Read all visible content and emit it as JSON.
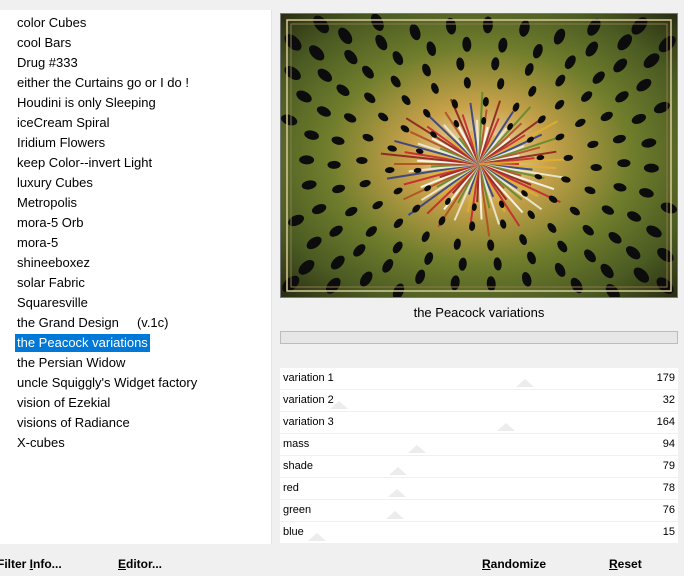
{
  "filters": [
    "color Cubes",
    "cool Bars",
    "Drug #333",
    "either the Curtains go or I do !",
    "Houdini is only Sleeping",
    "iceCream Spiral",
    "Iridium Flowers",
    "keep Color--invert Light",
    "luxury Cubes",
    "Metropolis",
    "mora-5 Orb",
    "mora-5",
    "shineeboxez",
    "solar Fabric",
    "Squaresville",
    "the Grand Design     (v.1c)",
    "the Peacock variations",
    "the Persian Widow",
    "uncle Squiggly's Widget factory",
    "vision of Ezekial",
    "visions of Radiance",
    "X-cubes"
  ],
  "selected_index": 16,
  "filter_title": "the Peacock variations",
  "sliders": [
    {
      "label": "variation 1",
      "value": 179,
      "max": 255
    },
    {
      "label": "variation 2",
      "value": 32,
      "max": 255
    },
    {
      "label": "variation 3",
      "value": 164,
      "max": 255
    },
    {
      "label": "mass",
      "value": 94,
      "max": 255
    },
    {
      "label": "shade",
      "value": 79,
      "max": 255
    },
    {
      "label": "red",
      "value": 78,
      "max": 255
    },
    {
      "label": "green",
      "value": 76,
      "max": 255
    },
    {
      "label": "blue",
      "value": 15,
      "max": 255
    }
  ],
  "buttons": {
    "filter_info_prefix": "Filter ",
    "filter_info_key": "I",
    "filter_info_rest": "nfo...",
    "editor_key": "E",
    "editor_rest": "ditor...",
    "randomize_key": "R",
    "randomize_rest": "andomize",
    "reset_key": "R",
    "reset_rest": "eset"
  },
  "colors": {
    "selection": "#0078d7",
    "thumb": "#ececec"
  }
}
